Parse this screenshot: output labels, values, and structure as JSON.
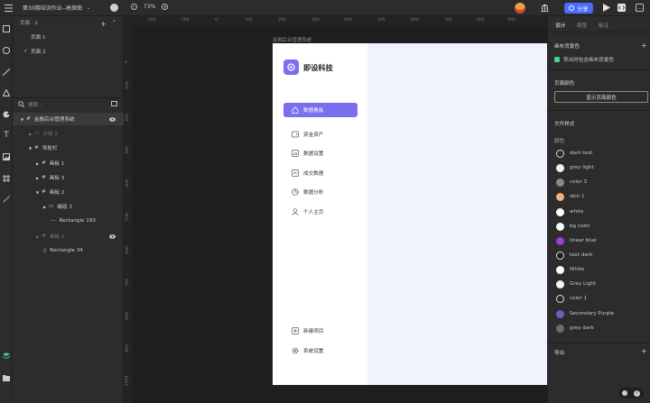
{
  "topbar": {
    "project_name": "第30期培训作业--高保图",
    "zoom": "73%",
    "share_label": "分享"
  },
  "layers_panel": {
    "pages_title": "页面 · 2",
    "pages": [
      "页面 1",
      "页面 2"
    ],
    "search_placeholder": "搜索...",
    "tree": [
      {
        "label": "金融后台管理系统",
        "indent": 0,
        "kind": "frame",
        "eye": true
      },
      {
        "label": "分组 2",
        "indent": 1,
        "kind": "group",
        "dim": true
      },
      {
        "label": "导航栏",
        "indent": 1,
        "kind": "frame"
      },
      {
        "label": "画板 1",
        "indent": 2,
        "kind": "frame"
      },
      {
        "label": "画板 3",
        "indent": 2,
        "kind": "frame"
      },
      {
        "label": "画板 2",
        "indent": 2,
        "kind": "frame"
      },
      {
        "label": "编组 3",
        "indent": 3,
        "kind": "group"
      },
      {
        "label": "Rectangle 193",
        "indent": 4,
        "kind": "rect"
      },
      {
        "label": "画板 2",
        "indent": 2,
        "kind": "frame",
        "dim": true,
        "eye": true
      },
      {
        "label": "Rectangle 34",
        "indent": 2,
        "kind": "rect"
      }
    ]
  },
  "canvas": {
    "ruler_top": [
      "-200",
      "-100",
      "0",
      "100",
      "200",
      "300",
      "400",
      "500",
      "600",
      "700",
      "800",
      "900"
    ],
    "ruler_left": [
      "0",
      "100",
      "200",
      "300",
      "400",
      "500",
      "600",
      "700",
      "800",
      "900",
      "1000",
      "1100"
    ],
    "frame_title": "金融后台管理系统",
    "app": {
      "brand": "即设科技",
      "nav": [
        {
          "label": "数据看板",
          "icon": "home-icon",
          "active": true
        },
        {
          "label": "资金资产",
          "icon": "wallet-icon"
        },
        {
          "label": "数据设置",
          "icon": "chart-settings-icon"
        },
        {
          "label": "成交数据",
          "icon": "deal-icon"
        },
        {
          "label": "数据分析",
          "icon": "pie-icon"
        },
        {
          "label": "个人主页",
          "icon": "user-icon"
        }
      ],
      "bottom_nav": [
        {
          "label": "新建项目",
          "icon": "plus-square-icon"
        },
        {
          "label": "系统设置",
          "icon": "gear-icon"
        }
      ]
    }
  },
  "right_panel": {
    "tabs": [
      "设计",
      "原型",
      "标注"
    ],
    "canvas_bg_title": "画布背景色",
    "export_bg_label": "导出时包含画布背景色",
    "page_color_title": "页面颜色",
    "page_color_button": "显示页面颜色",
    "file_styles_title": "文件样式",
    "colors_title": "颜色",
    "swatches": [
      {
        "name": "dark text",
        "color": "#2b2b2b",
        "ring": true
      },
      {
        "name": "grey light",
        "color": "#f2f2f2"
      },
      {
        "name": "color 3",
        "color": "#8a8a8a"
      },
      {
        "name": "skin 1",
        "color": "#f2b27a"
      },
      {
        "name": "white",
        "color": "#ffffff"
      },
      {
        "name": "bg color",
        "color": "#fafafa"
      },
      {
        "name": "linear blue",
        "color": "#9b3fd6"
      },
      {
        "name": "text dark",
        "color": "#1e1e1e",
        "ring": true
      },
      {
        "name": "White",
        "color": "#ffffff"
      },
      {
        "name": "Grey Light",
        "color": "#f5f5f5"
      },
      {
        "name": "color 1",
        "color": "#2b2b2b",
        "ring": true
      },
      {
        "name": "Secondary Purple",
        "color": "#6a5fc1"
      },
      {
        "name": "grey dark",
        "color": "#6e6e6e"
      }
    ],
    "export_label": "导出"
  },
  "accent": "#7b6ff0",
  "share_color": "#4b6bfb"
}
